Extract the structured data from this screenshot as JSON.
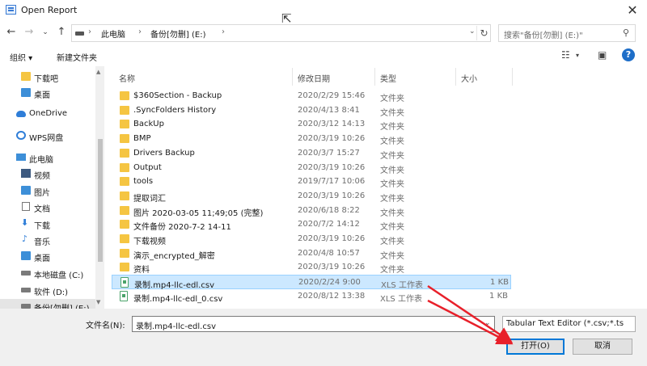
{
  "window": {
    "title": "Open Report"
  },
  "address": {
    "crumbs": [
      "此电脑",
      "备份[勿删] (E:)"
    ],
    "search_placeholder": "搜索\"备份[勿删] (E:)\""
  },
  "toolbar": {
    "organize": "组织 ▾",
    "new_folder": "新建文件夹"
  },
  "sidebar": {
    "items": [
      {
        "label": "下载吧",
        "icon": "folder-icon"
      },
      {
        "label": "桌面",
        "icon": "desktop-icon"
      },
      {
        "label": "OneDrive",
        "icon": "cloud-icon"
      },
      {
        "label": "WPS网盘",
        "icon": "network-icon"
      },
      {
        "label": "此电脑",
        "icon": "computer-icon"
      },
      {
        "label": "视频",
        "icon": "video-icon"
      },
      {
        "label": "图片",
        "icon": "pictures-icon"
      },
      {
        "label": "文档",
        "icon": "documents-icon"
      },
      {
        "label": "下载",
        "icon": "download-icon"
      },
      {
        "label": "音乐",
        "icon": "music-icon"
      },
      {
        "label": "桌面",
        "icon": "desktop-icon"
      },
      {
        "label": "本地磁盘 (C:)",
        "icon": "drive-icon"
      },
      {
        "label": "软件 (D:)",
        "icon": "drive-icon"
      },
      {
        "label": "备份[勿删] (E:)",
        "icon": "drive-icon"
      }
    ]
  },
  "columns": {
    "name": "名称",
    "date": "修改日期",
    "type": "类型",
    "size": "大小"
  },
  "files": [
    {
      "name": "$360Section - Backup",
      "date": "2020/2/29 15:46",
      "type": "文件夹",
      "size": "",
      "kind": "folder"
    },
    {
      "name": ".SyncFolders History",
      "date": "2020/4/13 8:41",
      "type": "文件夹",
      "size": "",
      "kind": "folder"
    },
    {
      "name": "BackUp",
      "date": "2020/3/12 14:13",
      "type": "文件夹",
      "size": "",
      "kind": "folder"
    },
    {
      "name": "BMP",
      "date": "2020/3/19 10:26",
      "type": "文件夹",
      "size": "",
      "kind": "folder"
    },
    {
      "name": "Drivers Backup",
      "date": "2020/3/7 15:27",
      "type": "文件夹",
      "size": "",
      "kind": "folder"
    },
    {
      "name": "Output",
      "date": "2020/3/19 10:26",
      "type": "文件夹",
      "size": "",
      "kind": "folder"
    },
    {
      "name": "tools",
      "date": "2019/7/17 10:06",
      "type": "文件夹",
      "size": "",
      "kind": "folder"
    },
    {
      "name": "提取词汇",
      "date": "2020/3/19 10:26",
      "type": "文件夹",
      "size": "",
      "kind": "folder"
    },
    {
      "name": "图片 2020-03-05 11;49;05 (完整)",
      "date": "2020/6/18 8:22",
      "type": "文件夹",
      "size": "",
      "kind": "folder"
    },
    {
      "name": "文件备份 2020-7-2 14-11",
      "date": "2020/7/2 14:12",
      "type": "文件夹",
      "size": "",
      "kind": "folder"
    },
    {
      "name": "下载视频",
      "date": "2020/3/19 10:26",
      "type": "文件夹",
      "size": "",
      "kind": "folder"
    },
    {
      "name": "演示_encrypted_解密",
      "date": "2020/4/8 10:57",
      "type": "文件夹",
      "size": "",
      "kind": "folder"
    },
    {
      "name": "资料",
      "date": "2020/3/19 10:26",
      "type": "文件夹",
      "size": "",
      "kind": "folder"
    },
    {
      "name": "录制.mp4-llc-edl.csv",
      "date": "2020/2/24 9:00",
      "type": "XLS 工作表",
      "size": "1 KB",
      "kind": "csv",
      "selected": true
    },
    {
      "name": "录制.mp4-llc-edl_0.csv",
      "date": "2020/8/12 13:38",
      "type": "XLS 工作表",
      "size": "1 KB",
      "kind": "csv"
    }
  ],
  "bottom": {
    "filename_label": "文件名(N):",
    "filename_value": "录制.mp4-llc-edl.csv",
    "filter_value": "Tabular Text Editor (*.csv;*.ts",
    "open_label": "打开(O)",
    "cancel_label": "取消"
  },
  "colors": {
    "accent": "#0078d7",
    "selection": "#cce8ff",
    "annotation_arrow": "#e8202a"
  }
}
